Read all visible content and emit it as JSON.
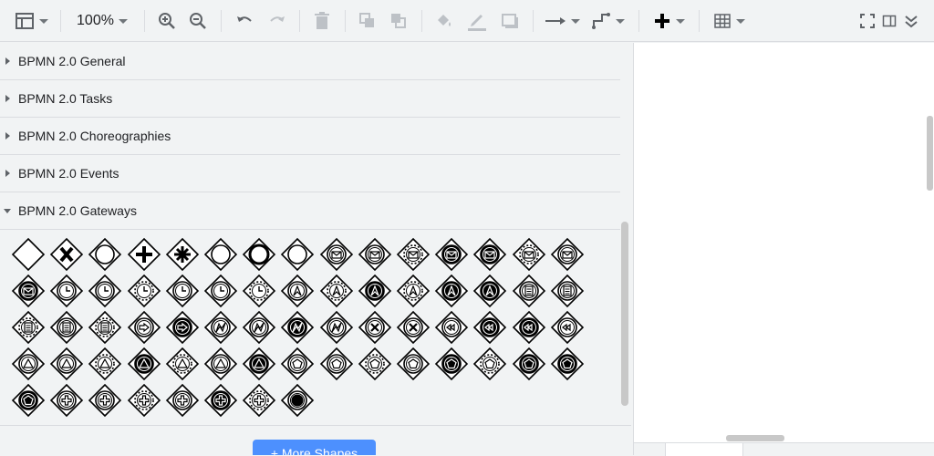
{
  "toolbar": {
    "zoom": "100%",
    "icons": [
      "view-icon",
      "zoom-in-icon",
      "zoom-out-icon",
      "undo-icon",
      "redo-icon",
      "delete-icon",
      "to-front-icon",
      "to-back-icon",
      "fill-color-icon",
      "line-color-icon",
      "shadow-icon",
      "connection-icon",
      "waypoints-icon",
      "insert-icon",
      "table-icon",
      "fullscreen-icon",
      "format-panel-icon",
      "collapse-icon"
    ]
  },
  "sidebar": {
    "sections": [
      {
        "label": "BPMN 2.0 General",
        "expanded": false
      },
      {
        "label": "BPMN 2.0 Tasks",
        "expanded": false
      },
      {
        "label": "BPMN 2.0 Choreographies",
        "expanded": false
      },
      {
        "label": "BPMN 2.0 Events",
        "expanded": false
      },
      {
        "label": "BPMN 2.0 Gateways",
        "expanded": true
      }
    ],
    "gateway_shapes": [
      "gateway-icon",
      "exclusive-gateway-icon",
      "gateway-event-icon",
      "parallel-gateway-icon",
      "complex-gateway-icon",
      "gateway-event-icon",
      "gateway-event-thick-icon",
      "gateway-event-icon",
      "gateway-message-icon",
      "gateway-message-icon",
      "gateway-message-dotted-icon",
      "gateway-message-filled-icon",
      "gateway-message-filled-icon",
      "gateway-message-dotted-icon",
      "gateway-message-icon",
      "gateway-message-filled-icon",
      "gateway-timer-icon",
      "gateway-timer-icon",
      "gateway-timer-dotted-icon",
      "gateway-timer-icon",
      "gateway-timer-icon",
      "gateway-timer-dotted-icon",
      "gateway-escalation-icon",
      "gateway-escalation-dotted-icon",
      "gateway-escalation-filled-icon",
      "gateway-escalation-dotted-icon",
      "gateway-escalation-filled-icon",
      "gateway-escalation-filled-icon",
      "gateway-conditional-icon",
      "gateway-conditional-icon",
      "gateway-conditional-dotted-icon",
      "gateway-conditional-icon",
      "gateway-conditional-dotted-icon",
      "gateway-link-icon",
      "gateway-link-filled-icon",
      "gateway-error-icon",
      "gateway-error-icon",
      "gateway-error-filled-icon",
      "gateway-error-icon",
      "gateway-cancel-icon",
      "gateway-cancel-icon",
      "gateway-compensation-icon",
      "gateway-compensation-filled-icon",
      "gateway-compensation-filled-icon",
      "gateway-compensation-icon",
      "gateway-signal-icon",
      "gateway-signal-icon",
      "gateway-signal-dotted-icon",
      "gateway-signal-filled-icon",
      "gateway-signal-dotted-icon",
      "gateway-signal-icon",
      "gateway-signal-filled-icon",
      "gateway-multiple-icon",
      "gateway-multiple-icon",
      "gateway-multiple-dotted-icon",
      "gateway-multiple-icon",
      "gateway-multiple-filled-icon",
      "gateway-multiple-dotted-icon",
      "gateway-multiple-filled-icon",
      "gateway-multiple-filled-icon",
      "gateway-multiple-filled-icon",
      "gateway-parallel-multiple-icon",
      "gateway-parallel-multiple-icon",
      "gateway-parallel-multiple-dotted-icon",
      "gateway-parallel-multiple-icon",
      "gateway-parallel-multiple-filled-icon",
      "gateway-parallel-multiple-dotted-icon",
      "gateway-terminate-icon"
    ],
    "more_shapes_label": "+ More Shapes"
  },
  "colors": {
    "accent": "#4d90fe",
    "background": "#f1f3f4",
    "border": "#dadce0"
  }
}
